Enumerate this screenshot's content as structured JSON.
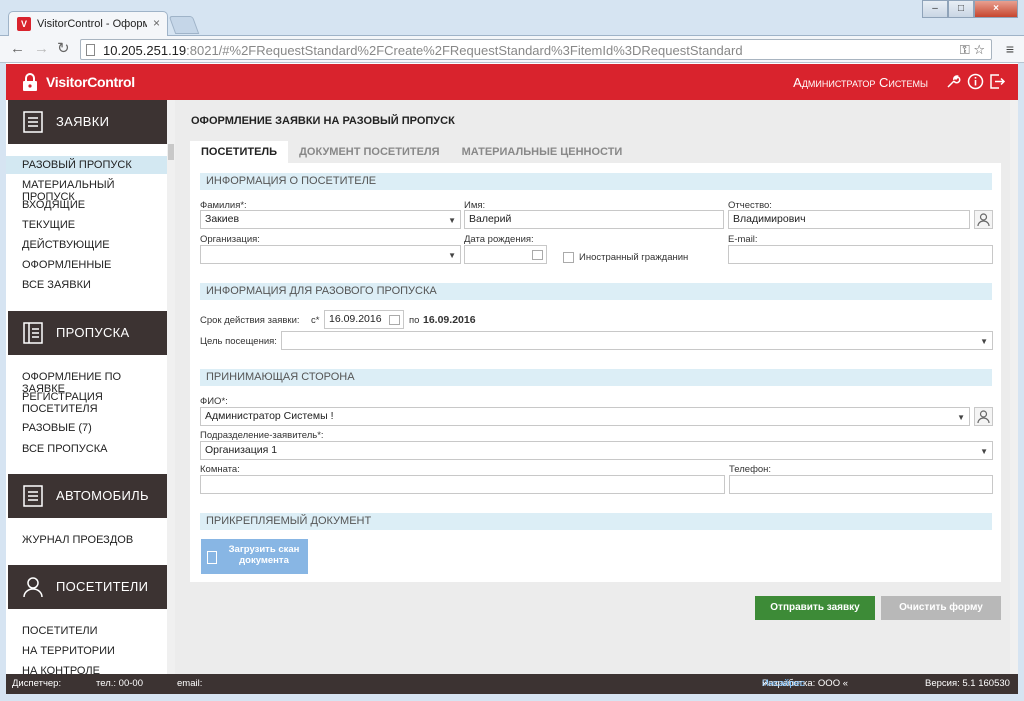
{
  "browser": {
    "tab_title": "VisitorControl - Оформле",
    "url_host": "10.205.251.19",
    "url_rest": ":8021/#%2FRequestStandard%2FCreate%2FRequestStandard%3FitemId%3DRequestStandard",
    "favicon_letter": "V"
  },
  "header": {
    "logo_text": "VisitorControl",
    "user_name": "Администратор Системы",
    "accent": "#d9232d"
  },
  "sidebar": {
    "sections": [
      {
        "title": "ЗАЯВКИ",
        "icon": "list-icon",
        "items": [
          {
            "label": "РАЗОВЫЙ ПРОПУСК",
            "active": true
          },
          {
            "label": "МАТЕРИАЛЬНЫЙ ПРОПУСК"
          },
          {
            "label": "ВХОДЯЩИЕ"
          },
          {
            "label": "ТЕКУЩИЕ"
          },
          {
            "label": "ДЕЙСТВУЮЩИЕ"
          },
          {
            "label": "ОФОРМЛЕННЫЕ"
          },
          {
            "label": "ВСЕ ЗАЯВКИ"
          }
        ]
      },
      {
        "title": "ПРОПУСКА",
        "icon": "pass-icon",
        "items": [
          {
            "label": "ОФОРМЛЕНИЕ ПО ЗАЯВКЕ"
          },
          {
            "label": "РЕГИСТРАЦИЯ ПОСЕТИТЕЛЯ"
          },
          {
            "label": "РАЗОВЫЕ (7)"
          },
          {
            "label": "ВСЕ ПРОПУСКА"
          }
        ]
      },
      {
        "title": "АВТОМОБИЛЬ",
        "icon": "list-icon",
        "items": [
          {
            "label": "ЖУРНАЛ ПРОЕЗДОВ"
          }
        ]
      },
      {
        "title": "ПОСЕТИТЕЛИ",
        "icon": "person-icon",
        "items": [
          {
            "label": "ПОСЕТИТЕЛИ"
          },
          {
            "label": "НА ТЕРРИТОРИИ"
          },
          {
            "label": "НА КОНТРОЛЕ"
          }
        ]
      }
    ]
  },
  "main": {
    "page_title": "ОФОРМЛЕНИЕ ЗАЯВКИ НА РАЗОВЫЙ ПРОПУСК",
    "tabs": [
      {
        "label": "ПОСЕТИТЕЛЬ",
        "active": true
      },
      {
        "label": "ДОКУМЕНТ ПОСЕТИТЕЛЯ"
      },
      {
        "label": "МАТЕРИАЛЬНЫЕ ЦЕННОСТИ"
      }
    ],
    "visitor": {
      "section_title": "ИНФОРМАЦИЯ О ПОСЕТИТЕЛЕ",
      "lastname_label": "Фамилия*:",
      "lastname_value": "Закиев",
      "firstname_label": "Имя:",
      "firstname_value": "Валерий",
      "patronymic_label": "Отчество:",
      "patronymic_value": "Владимирович",
      "org_label": "Организация:",
      "org_value": "",
      "birth_label": "Дата рождения:",
      "birth_value": "",
      "foreign_label": "Иностранный гражданин",
      "email_label": "E-mail:",
      "email_value": ""
    },
    "pass": {
      "section_title": "ИНФОРМАЦИЯ ДЛЯ РАЗОВОГО ПРОПУСКА",
      "period_label": "Срок действия заявки:",
      "from_label": "с*",
      "from_value": "16.09.2016",
      "to_label": "по",
      "to_value": "16.09.2016",
      "purpose_label": "Цель посещения:",
      "purpose_value": ""
    },
    "host": {
      "section_title": "ПРИНИМАЮЩАЯ СТОРОНА",
      "fio_label": "ФИО*:",
      "fio_value": "Администратор Системы !",
      "dept_label": "Подразделение-заявитель*:",
      "dept_value": "Организация 1",
      "room_label": "Комната:",
      "room_value": "",
      "phone_label": "Телефон:",
      "phone_value": ""
    },
    "attach": {
      "section_title": "ПРИКРЕПЛЯЕМЫЙ ДОКУМЕНТ",
      "upload_label": "Загрузить скан документа"
    },
    "submit_label": "Отправить заявку",
    "clear_label": "Очистить форму"
  },
  "footer": {
    "dispatcher": "Диспетчер:",
    "phone": "тел.: 00-00",
    "email": "email:",
    "dev_prefix": "Разработка: ООО «",
    "dev_name": "Инсайрес",
    "dev_suffix": "»",
    "version": "Версия: 5.1 160530"
  }
}
